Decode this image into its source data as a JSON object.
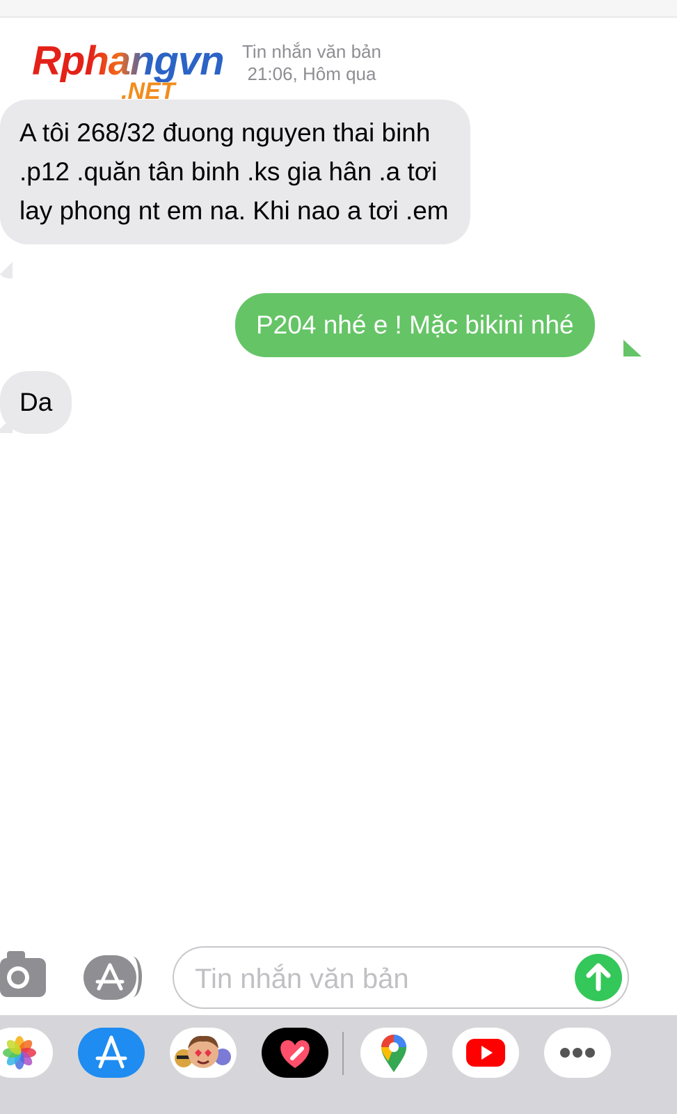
{
  "watermark": {
    "brand": "Rphangvn",
    "suffix": ".NET"
  },
  "header": {
    "kind": "Tin nhắn văn bản",
    "time": "21:06, Hôm qua"
  },
  "messages": [
    {
      "side": "incoming",
      "text": "A tôi 268/32 đuong nguyen thai binh .p12 .quăn tân binh .ks gia hân .a tơi lay phong nt em na. Khi nao a tơi .em"
    },
    {
      "side": "outgoing",
      "text": "P204 nhé e ! Mặc bikini nhé"
    },
    {
      "side": "incoming",
      "text": "Da"
    }
  ],
  "composer": {
    "placeholder": "Tin nhắn văn bản",
    "value": ""
  },
  "colors": {
    "incoming_bubble": "#e9e9eb",
    "outgoing_bubble": "#65c466",
    "send_button": "#34c759"
  },
  "app_tray": {
    "icons": [
      "photos-icon",
      "app-store-icon",
      "memoji-icon",
      "digital-touch-icon",
      "google-maps-icon",
      "youtube-icon",
      "more-icon"
    ]
  }
}
